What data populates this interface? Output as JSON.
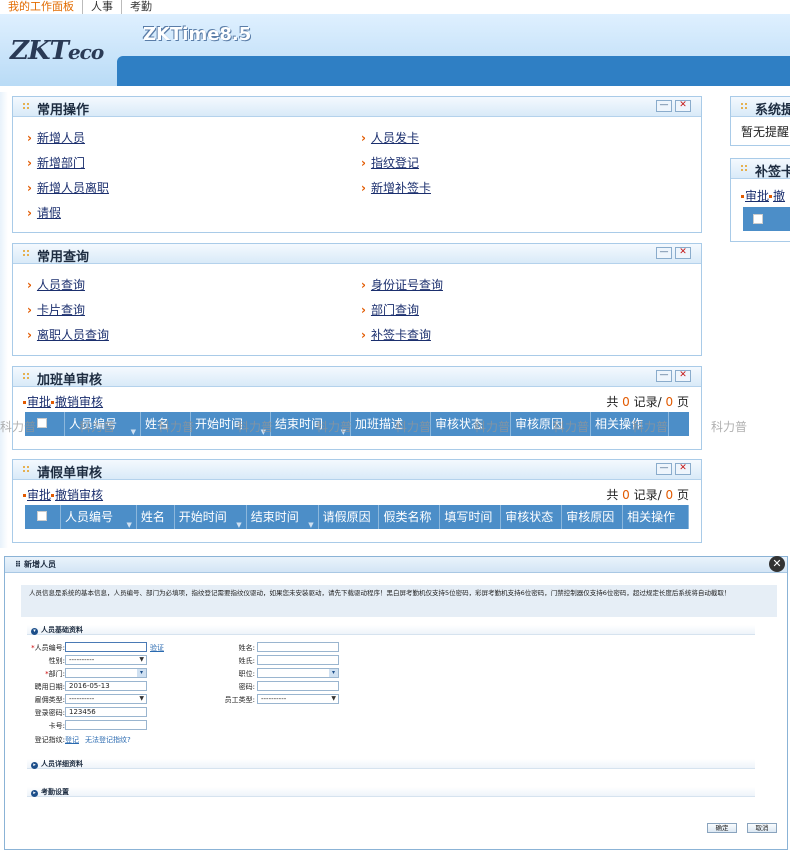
{
  "topnav": {
    "items": [
      "我的工作面板",
      "人事",
      "考勤"
    ]
  },
  "header": {
    "logo": "ZKT",
    "logo_suffix": "eco",
    "app_name": "ZKTime8.5"
  },
  "common_ops": {
    "title": "常用操作",
    "links": [
      "新增人员",
      "人员发卡",
      "新增部门",
      "指纹登记",
      "新增人员离职",
      "新增补签卡",
      "请假"
    ]
  },
  "common_query": {
    "title": "常用查询",
    "links": [
      "人员查询",
      "身份证号查询",
      "卡片查询",
      "部门查询",
      "离职人员查询",
      "补签卡查询"
    ]
  },
  "overtime_review": {
    "title": "加班单审核",
    "approve": "审批",
    "cancel": "撤销审核",
    "pager": {
      "prefix": "共",
      "records": "0",
      "records_label": "记录/",
      "pages": "0",
      "pages_label": "页"
    },
    "columns": [
      "人员编号",
      "姓名",
      "开始时间",
      "结束时间",
      "加班描述",
      "审核状态",
      "审核原因",
      "相关操作"
    ]
  },
  "leave_review": {
    "title": "请假单审核",
    "approve": "审批",
    "cancel": "撤销审核",
    "pager": {
      "prefix": "共",
      "records": "0",
      "records_label": "记录/",
      "pages": "0",
      "pages_label": "页"
    },
    "columns": [
      "人员编号",
      "姓名",
      "开始时间",
      "结束时间",
      "请假原因",
      "假类名称",
      "填写时间",
      "审核状态",
      "审核原因",
      "相关操作"
    ]
  },
  "side": {
    "sys_title": "系统提",
    "sys_text": "暂无提醒",
    "supp_title": "补签卡",
    "supp_approve": "审批",
    "supp_cancel": "撤"
  },
  "watermark": "科力普",
  "dialog": {
    "title": "新增人员",
    "note": "人员信息是系统的基本信息，人员编号、部门为必填项，指纹登记需要指纹仪驱动，如果您未安装驱动，请先下载驱动程序！黑白屏考勤机仅支持5位密码，彩屏考勤机支持6位密码，门禁控制器仅支持6位密码，超过规定长度后系统将自动截取！",
    "sections": {
      "basic": "人员基础资料",
      "detail": "人员详细资料",
      "attendance": "考勤设置"
    },
    "labels": {
      "emp_no": "人员编号:",
      "name": "姓名:",
      "gender": "性别:",
      "surname": "姓氏:",
      "dept": "部门:",
      "position": "职位:",
      "hire_date": "聘用日期:",
      "password": "密码:",
      "employ_type": "雇佣类型:",
      "staff_type": "员工类型:",
      "login_pwd": "登录密码:",
      "card_no": "卡号:",
      "fingerprint": "登记指纹:"
    },
    "values": {
      "gender": "----------",
      "hire_date": "2016-05-13",
      "employ_type": "----------",
      "staff_type": "----------",
      "login_pwd": "123456"
    },
    "verify_link": "验证",
    "register_link": "登记",
    "cannot_register": "无法登记指纹?",
    "ok": "确定",
    "cancel": "取消"
  }
}
